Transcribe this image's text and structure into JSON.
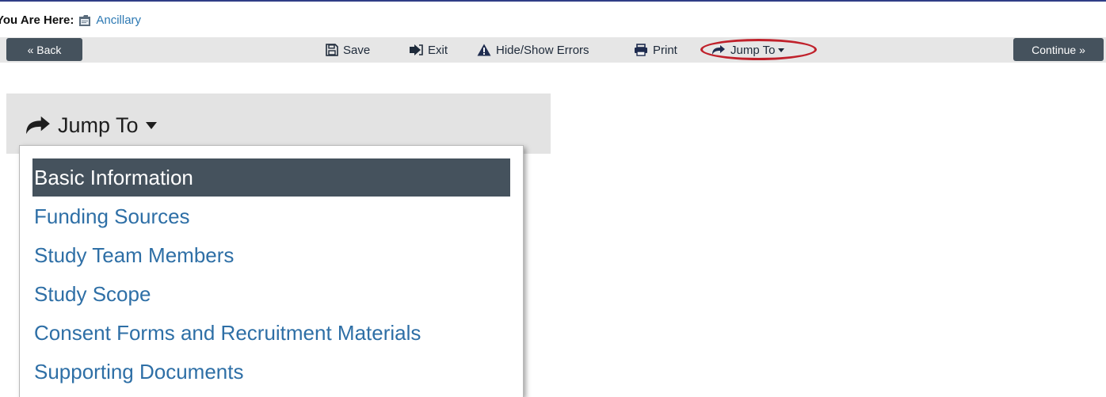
{
  "breadcrumb": {
    "prefix": "You Are Here:",
    "link": "Ancillary",
    "icon": "document-folder-icon"
  },
  "toolbar": {
    "back_label": "« Back",
    "continue_label": "Continue »",
    "save_label": "Save",
    "exit_label": "Exit",
    "errors_label": "Hide/Show Errors",
    "print_label": "Print",
    "jump_label": "Jump To"
  },
  "jump_menu": {
    "header": "Jump To",
    "items": [
      {
        "label": "Basic Information",
        "active": true
      },
      {
        "label": "Funding Sources",
        "active": false
      },
      {
        "label": "Study Team Members",
        "active": false
      },
      {
        "label": "Study Scope",
        "active": false
      },
      {
        "label": "Consent Forms and Recruitment Materials",
        "active": false
      },
      {
        "label": "Supporting Documents",
        "active": false
      }
    ]
  },
  "colors": {
    "accent_dark": "#45525d",
    "link_blue": "#2e6fa6",
    "highlight_red": "#c0212b",
    "toolbar_bg": "#e6e6e6"
  }
}
